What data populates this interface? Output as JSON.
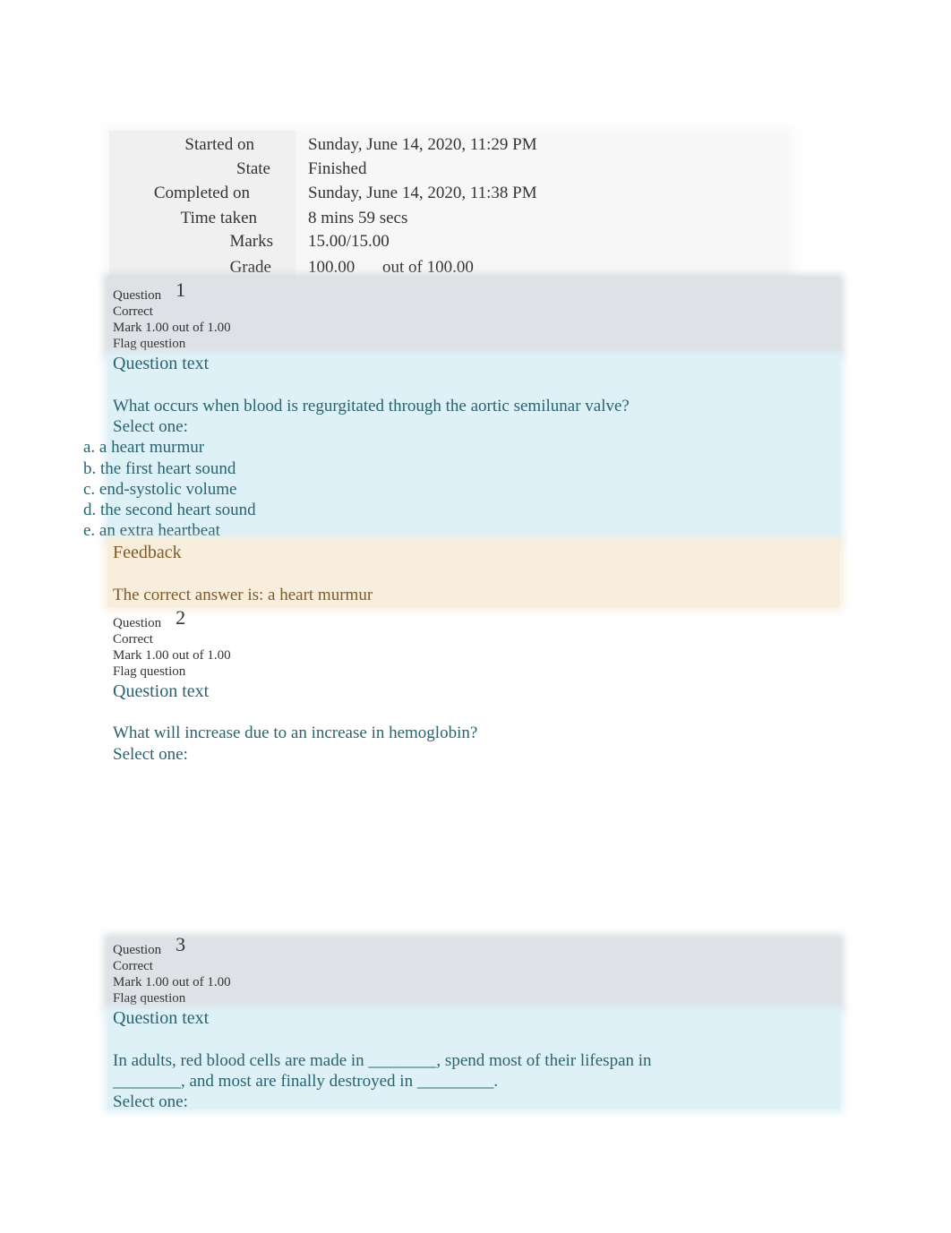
{
  "summary": {
    "rows": [
      {
        "label": "Started on",
        "value": "Sunday, June 14, 2020, 11:29 PM"
      },
      {
        "label": "State",
        "value": "Finished"
      },
      {
        "label": "Completed on",
        "value": "Sunday, June 14, 2020, 11:38 PM"
      },
      {
        "label": "Time taken",
        "value": "8 mins 59 secs"
      },
      {
        "label": "Marks",
        "value": "15.00/15.00"
      },
      {
        "label": "Grade",
        "value": "100.00",
        "value_suffix": "out of 100.00"
      }
    ]
  },
  "questions": [
    {
      "label": "Question",
      "number": "1",
      "status": "Correct",
      "mark": "Mark 1.00 out of 1.00",
      "flag": "Flag question",
      "section_title": "Question text",
      "text_lines": [
        "What occurs when blood is regurgitated through the aortic semilunar valve?"
      ],
      "select_prompt": "Select one:",
      "options": [
        "a. a heart murmur",
        "b. the first heart sound",
        "c. end-systolic volume",
        "d. the second heart sound",
        "e. an extra heartbeat"
      ],
      "feedback_title": "Feedback",
      "feedback_text": "The correct answer is: a heart murmur"
    },
    {
      "label": "Question",
      "number": "2",
      "status": "Correct",
      "mark": "Mark 1.00 out of 1.00",
      "flag": "Flag question",
      "section_title": "Question text",
      "text_lines": [
        "What will increase due to an increase in hemoglobin?"
      ],
      "select_prompt": "Select one:"
    },
    {
      "label": "Question",
      "number": "3",
      "status": "Correct",
      "mark": "Mark 1.00 out of 1.00",
      "flag": "Flag question",
      "section_title": "Question text",
      "text_lines": [
        "In adults, red blood cells are made in ________, spend most of their lifespan in",
        "________, and most are finally destroyed in _________."
      ],
      "select_prompt": "Select one:"
    }
  ],
  "colors": {
    "question_text": "#2a6270",
    "feedback_text": "#7d5a29",
    "header_bg": "#dee1e5",
    "content_bg": "#ddf1f7",
    "feedback_bg": "#f9eedc"
  }
}
